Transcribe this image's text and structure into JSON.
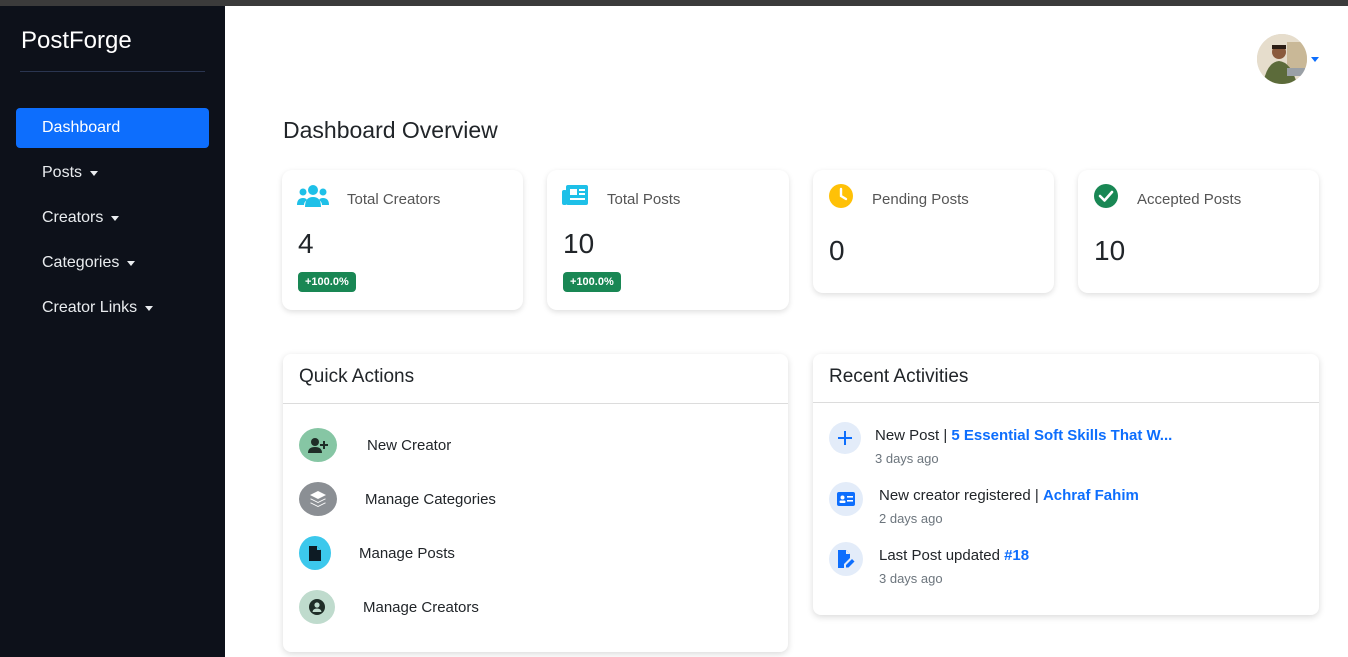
{
  "sidebar": {
    "brand": "PostForge",
    "items": [
      {
        "label": "Dashboard",
        "active": true
      },
      {
        "label": "Posts"
      },
      {
        "label": "Creators"
      },
      {
        "label": "Categories"
      },
      {
        "label": "Creator Links"
      }
    ]
  },
  "header": {
    "avatar_icon": "user-avatar"
  },
  "main": {
    "title": "Dashboard Overview",
    "stats": [
      {
        "label": "Total Creators",
        "value": "4",
        "badge": "+100.0%",
        "icon": "users-icon",
        "color": "#1ec0e8"
      },
      {
        "label": "Total Posts",
        "value": "10",
        "badge": "+100.0%",
        "icon": "newspaper-icon",
        "color": "#1ec0e8"
      },
      {
        "label": "Pending Posts",
        "value": "0",
        "icon": "clock-icon",
        "color": "#ffc107"
      },
      {
        "label": "Accepted Posts",
        "value": "10",
        "icon": "check-circle-icon",
        "color": "#198754"
      }
    ],
    "quick_actions": {
      "title": "Quick Actions",
      "items": [
        {
          "label": "New Creator",
          "icon": "user-plus-icon",
          "color": "#86c6a4"
        },
        {
          "label": "Manage Categories",
          "icon": "layers-icon",
          "color": "#8b8f94"
        },
        {
          "label": "Manage Posts",
          "icon": "file-icon",
          "color": "#3cc8ec"
        },
        {
          "label": "Manage Creators",
          "icon": "user-circle-icon",
          "color": "#bfdbcd"
        }
      ]
    },
    "recent_activities": {
      "title": "Recent Activities",
      "items": [
        {
          "prefix": "New Post | ",
          "link": "5 Essential Soft Skills That W...",
          "time": "3 days ago",
          "icon": "plus-icon"
        },
        {
          "prefix": "New creator registered | ",
          "link": "Achraf Fahim",
          "time": "2 days ago",
          "icon": "id-card-icon"
        },
        {
          "prefix": "Last Post updated ",
          "link": "#18",
          "time": "3 days ago",
          "icon": "edit-file-icon"
        }
      ]
    }
  },
  "colors": {
    "accent": "#0d6efd",
    "success": "#198754",
    "sidebar_bg": "#0d111a"
  }
}
